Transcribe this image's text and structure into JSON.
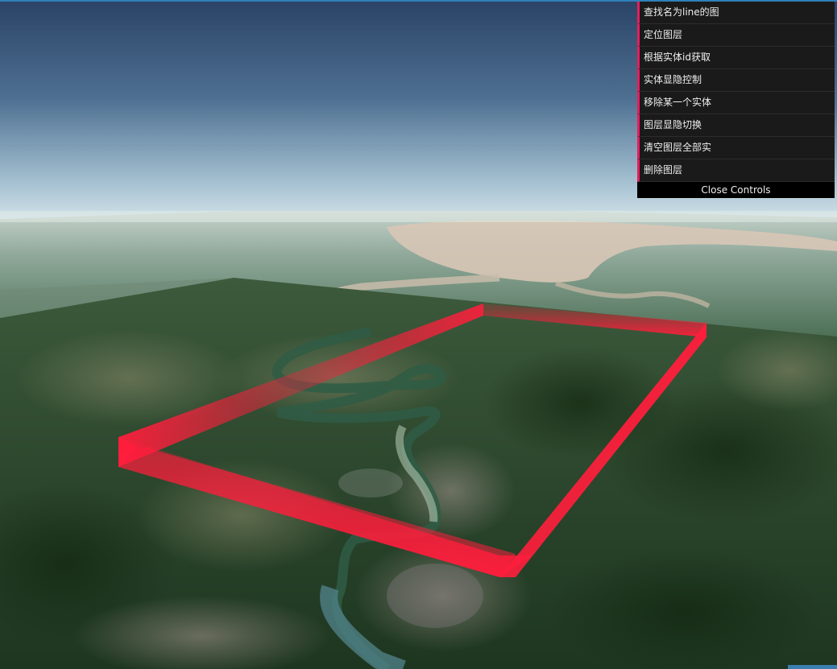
{
  "controls": {
    "items": [
      {
        "label": "查找名为line的图"
      },
      {
        "label": "定位图层"
      },
      {
        "label": "根据实体id获取"
      },
      {
        "label": "实体显隐控制"
      },
      {
        "label": "移除某一个实体"
      },
      {
        "label": "图层显隐切换"
      },
      {
        "label": "清空图层全部实"
      },
      {
        "label": "删除图层"
      }
    ],
    "close_label": "Close Controls",
    "accent_color": "#e61d5f"
  },
  "scene": {
    "wall_color": "#ff1e3c",
    "sky_top_color": "#2c4668",
    "sky_bottom_color": "#c9dde6"
  }
}
